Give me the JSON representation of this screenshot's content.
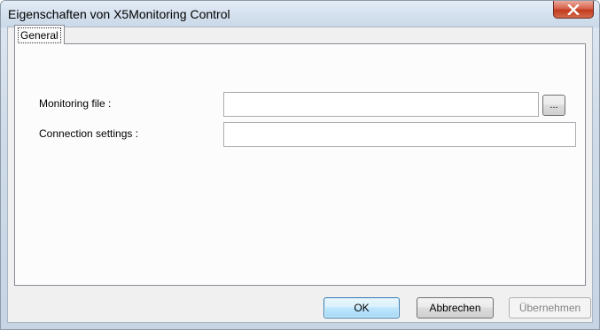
{
  "window": {
    "title": "Eigenschaften von X5Monitoring Control",
    "close_symbol": "×"
  },
  "tabs": [
    {
      "label": "General",
      "selected": true
    }
  ],
  "fields": {
    "monitoring_file": {
      "label": "Monitoring file :",
      "value": "",
      "browse_label": "..."
    },
    "connection_settings": {
      "label": "Connection settings :",
      "value": ""
    }
  },
  "buttons": {
    "ok": "OK",
    "cancel": "Abbrechen",
    "apply": "Übernehmen",
    "apply_enabled": false
  },
  "icons": {
    "close": "close-icon"
  },
  "colors": {
    "close_button": "#c23a1f",
    "default_button_border": "#3c7fb1"
  }
}
